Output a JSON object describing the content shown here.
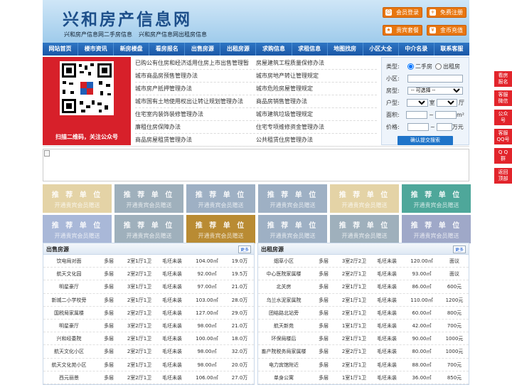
{
  "header": {
    "logo": "兴和房产信息网",
    "slogan": [
      "兴和房产信息网二手房信息",
      "兴和房产信息网出租房信息"
    ],
    "buttons": [
      {
        "label": "会员登录",
        "icon": "user-icon"
      },
      {
        "label": "免费注册",
        "icon": "register-icon"
      },
      {
        "label": "贵宾套餐",
        "icon": "vip-icon"
      },
      {
        "label": "金币充值",
        "icon": "coin-icon"
      }
    ]
  },
  "nav": [
    "网站首页",
    "楼市资讯",
    "新房楼盘",
    "看房报名",
    "出售房源",
    "出租房源",
    "求购信息",
    "求租信息",
    "地图找房",
    "小区大全",
    "中介名录",
    "联系客服"
  ],
  "qr_caption": "扫描二维码，关注公众号",
  "links": [
    [
      "已购公有住房和经济适用住房上市出售管理暂",
      "房屋建筑工程质量保修办法"
    ],
    [
      "城市商品房预售管理办法",
      "城市房地产转让管理规定"
    ],
    [
      "城市房产抵押管理办法",
      "城市危险房屋管理规定"
    ],
    [
      "城市国有土地使用权出让转让规划管理办法",
      "商品房销售管理办法"
    ],
    [
      "住宅室内装饰装修管理办法",
      "城市建筑垃圾管理规定"
    ],
    [
      "廉租住房保障办法",
      "住宅专项维修资金管理办法"
    ],
    [
      "商品房屋租赁管理办法",
      "公共租赁住房管理办法"
    ]
  ],
  "search": {
    "type_label": "类型:",
    "opt1": "二手房",
    "opt2": "出租房",
    "district_label": "小区:",
    "room_label": "房型:",
    "room_select": "-- 可选择 --",
    "unit_label": "户型:",
    "shi": "室",
    "ting": "厅",
    "area_label": "面积:",
    "area_unit": "m²",
    "price_label": "价格:",
    "price_unit": "万元",
    "tilde": "~",
    "submit": "确认提交搜索"
  },
  "ads": {
    "title": "推 荐 单 位",
    "sub": "开通贵宾会员赠送",
    "colors": [
      "#e4d3a6",
      "#9fb0bc",
      "#9eb0c4",
      "#9eb0c4",
      "#e4d3a6",
      "#4ea79a",
      "#a9b8d8",
      "#9fb0bc",
      "#b98b33",
      "#9eb0c4",
      "#9fb0bc",
      "#9fa8c8"
    ]
  },
  "sale": {
    "title": "出售房源",
    "more": "更多",
    "rows": [
      [
        "饮电局对面",
        "多层",
        "2室1厅1卫",
        "毛坯未装",
        "104.00㎡",
        "19.0万"
      ],
      [
        "航天文化园",
        "多层",
        "2室2厅1卫",
        "毛坯未装",
        "92.00㎡",
        "19.5万"
      ],
      [
        "明星豪厅",
        "多层",
        "3室1厅1卫",
        "毛坯未装",
        "97.00㎡",
        "21.0万"
      ],
      [
        "新城二小学校旁",
        "多层",
        "2室1厅1卫",
        "毛坯未装",
        "103.00㎡",
        "28.0万"
      ],
      [
        "国税局家属楼",
        "多层",
        "2室2厅1卫",
        "毛坯未装",
        "127.00㎡",
        "29.0万"
      ],
      [
        "明星豪厅",
        "多层",
        "3室2厅1卫",
        "毛坯未装",
        "98.00㎡",
        "21.0万"
      ],
      [
        "兴和经委院",
        "多层",
        "2室1厅1卫",
        "毛坯未装",
        "100.00㎡",
        "18.0万"
      ],
      [
        "航天文化小区",
        "多层",
        "2室2厅1卫",
        "毛坯未装",
        "98.00㎡",
        "32.0万"
      ],
      [
        "航天文化苑小区",
        "多层",
        "2室1厅1卫",
        "毛坯未装",
        "98.00㎡",
        "20.0万"
      ],
      [
        "西元丽景",
        "多层",
        "2室2厅1卫",
        "毛坯未装",
        "106.00㎡",
        "27.0万"
      ]
    ]
  },
  "rent": {
    "title": "出租房源",
    "more": "更多",
    "rows": [
      [
        "烟草小区",
        "多层",
        "3室2厅2卫",
        "毛坯未装",
        "120.00㎡",
        "面议"
      ],
      [
        "中心医院家属楼",
        "多层",
        "2室2厅1卫",
        "毛坯未装",
        "93.00㎡",
        "面议"
      ],
      [
        "北关房",
        "多层",
        "2室1厅1卫",
        "毛坯未装",
        "86.00㎡",
        "600元"
      ],
      [
        "乌兰水泥家属院",
        "多层",
        "2室1厅1卫",
        "毛坯未装",
        "110.00㎡",
        "1200元"
      ],
      [
        "团结路北站旁",
        "多层",
        "2室1厅1卫",
        "毛坯未装",
        "60.00㎡",
        "800元"
      ],
      [
        "航天新苑",
        "多层",
        "1室1厅1卫",
        "毛坯未装",
        "42.00㎡",
        "700元"
      ],
      [
        "环保局楼后",
        "多层",
        "2室1厅1卫",
        "毛坯未装",
        "90.00㎡",
        "1000元"
      ],
      [
        "畜产院税务局家属楼",
        "多层",
        "2室2厅1卫",
        "毛坯未装",
        "80.00㎡",
        "1000元"
      ],
      [
        "电力宾馆附近",
        "多层",
        "2室1厅1卫",
        "毛坯未装",
        "88.00㎡",
        "700元"
      ],
      [
        "单身公寓",
        "多层",
        "1室1厅1卫",
        "毛坯未装",
        "36.00㎡",
        "850元"
      ]
    ]
  },
  "side": [
    {
      "l1": "看房",
      "l2": "报名"
    },
    {
      "l1": "客服",
      "l2": "微信"
    },
    {
      "l1": "公众",
      "l2": "号"
    },
    {
      "l1": "客服",
      "l2": "QQ号"
    },
    {
      "l1": "Q Q",
      "l2": "群"
    },
    {
      "l1": "返回",
      "l2": "顶部"
    }
  ]
}
